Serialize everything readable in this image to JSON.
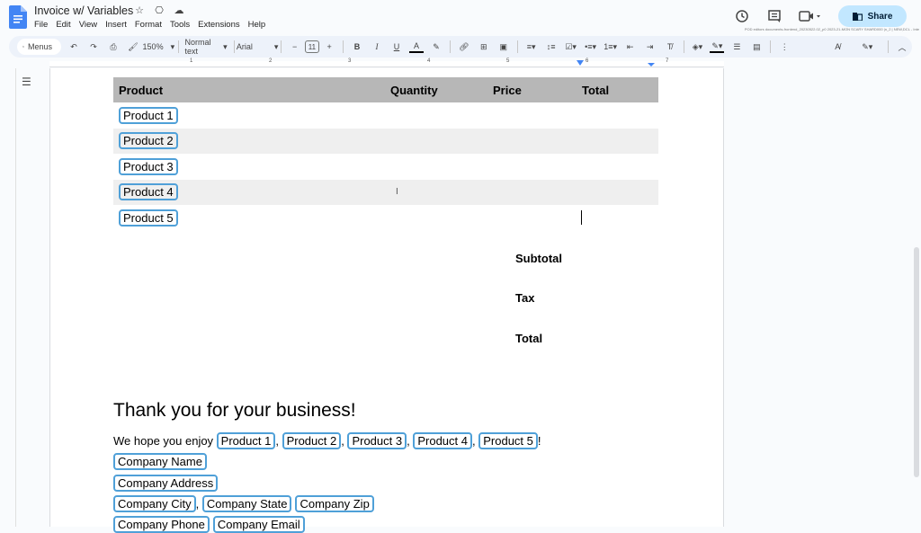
{
  "app": {
    "doc_title": "Invoice w/ Variables",
    "title_icons": [
      "star-icon",
      "move-to-folder-icon",
      "cloud-saved-icon"
    ],
    "menu": [
      "File",
      "Edit",
      "View",
      "Insert",
      "Format",
      "Tools",
      "Extensions",
      "Help"
    ],
    "share_label": "Share",
    "build_info": "POD editors documents-frontend_20230522.02_p0 2023-21-MON SCARY SHARD000 |n_2 | NEW,DCL - Inte",
    "accent": "#c2e7ff",
    "chip_border": "#4fa0d8"
  },
  "toolbar": {
    "menus_label": "Menus",
    "zoom": "150%",
    "style": "Normal text",
    "font": "Arial",
    "font_size": "11",
    "minus": "−",
    "plus": "+"
  },
  "ruler": {
    "numbers": [
      "1",
      "2",
      "3",
      "4",
      "5",
      "6",
      "7"
    ]
  },
  "document": {
    "table": {
      "headers": [
        "Product",
        "Quantity",
        "Price",
        "Total"
      ],
      "rows": [
        {
          "product": "Product 1",
          "quantity": "",
          "price": "",
          "total": ""
        },
        {
          "product": "Product 2",
          "quantity": "",
          "price": "",
          "total": ""
        },
        {
          "product": "Product 3",
          "quantity": "",
          "price": "",
          "total": ""
        },
        {
          "product": "Product 4",
          "quantity": "",
          "price": "",
          "total": ""
        },
        {
          "product": "Product 5",
          "quantity": "",
          "price": "",
          "total": ""
        }
      ]
    },
    "summary": {
      "subtotal": "Subtotal",
      "tax": "Tax",
      "total": "Total"
    },
    "thanks_heading": "Thank you for your business!",
    "enjoy_prefix": "We hope you enjoy ",
    "enjoy_products": [
      "Product 1",
      "Product 2",
      "Product 3",
      "Product 4",
      "Product 5"
    ],
    "comma": ", ",
    "exclaim": "!",
    "company": {
      "name": "Company Name",
      "address": "Company Address",
      "city": "Company City",
      "state": "Company State",
      "zip": "Company Zip",
      "phone": "Company Phone",
      "email": "Company Email"
    }
  }
}
